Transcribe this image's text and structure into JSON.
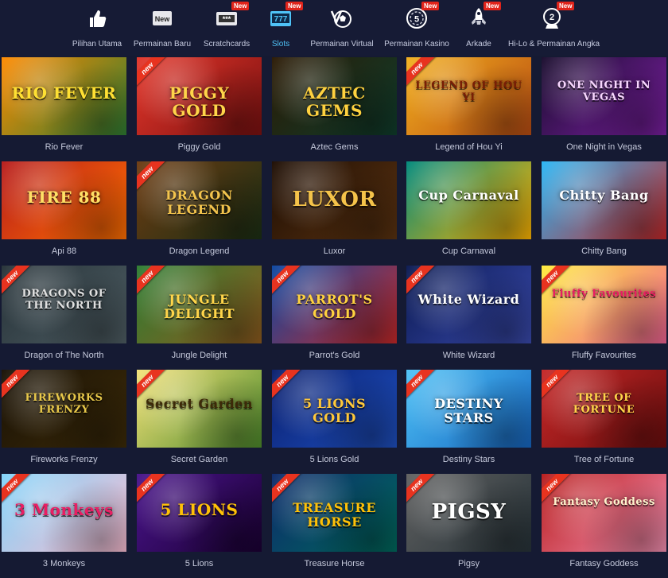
{
  "nav": {
    "items": [
      {
        "label": "Pilihan Utama",
        "icon": "thumbs-up-icon",
        "new": false,
        "active": false
      },
      {
        "label": "Permainan Baru",
        "icon": "new-box-icon",
        "new": false,
        "active": false
      },
      {
        "label": "Scratchcards",
        "icon": "scratchcard-icon",
        "new": true,
        "active": false
      },
      {
        "label": "Slots",
        "icon": "slot-777-icon",
        "new": true,
        "active": true
      },
      {
        "label": "Permainan Virtual",
        "icon": "soccer-v-icon",
        "new": false,
        "active": false
      },
      {
        "label": "Permainan Kasino",
        "icon": "casino-chip-icon",
        "new": true,
        "active": false
      },
      {
        "label": "Arkade",
        "icon": "rocket-icon",
        "new": true,
        "active": false
      },
      {
        "label": "Hi-Lo & Permainan Angka",
        "icon": "lottery-icon",
        "new": true,
        "active": false
      }
    ],
    "new_badge": "New",
    "new_box_text": "New",
    "scratch_text": "***",
    "slot_text": "777",
    "chip_text": "5",
    "lottery_text": "2"
  },
  "ribbon_text": "new",
  "games": [
    {
      "name": "Rio Fever",
      "art": "RIO FEVER",
      "new": false,
      "c1": "#ff8a00",
      "c2": "#2e7d32",
      "tc": "#ffe033"
    },
    {
      "name": "Piggy Gold",
      "art": "PIGGY GOLD",
      "new": true,
      "c1": "#e5372b",
      "c2": "#7a1010",
      "tc": "#ffd54a"
    },
    {
      "name": "Aztec Gems",
      "art": "AZTEC GEMS",
      "new": false,
      "c1": "#2b1a05",
      "c2": "#0f3d2c",
      "tc": "#ffd23f"
    },
    {
      "name": "Legend of Hou Yi",
      "art": "LEGEND OF HOU YI",
      "new": true,
      "c1": "#f2b01e",
      "c2": "#b84b12",
      "tc": "#7a1e05"
    },
    {
      "name": "One Night in Vegas",
      "art": "ONE NIGHT IN VEGAS",
      "new": false,
      "c1": "#1a0d2e",
      "c2": "#7b1fa2",
      "tc": "#f8d7ff"
    },
    {
      "name": "Api 88",
      "art": "FIRE 88",
      "new": false,
      "c1": "#b71c1c",
      "c2": "#ff6f00",
      "tc": "#ffe066"
    },
    {
      "name": "Dragon Legend",
      "art": "DRAGON LEGEND",
      "new": true,
      "c1": "#6d3b12",
      "c2": "#1b2f14",
      "tc": "#f3c44d"
    },
    {
      "name": "Luxor",
      "art": "LUXOR",
      "new": false,
      "c1": "#1e0e04",
      "c2": "#5a3210",
      "tc": "#f5c34a"
    },
    {
      "name": "Cup Carnaval",
      "art": "Cup Carnaval",
      "new": false,
      "c1": "#00897b",
      "c2": "#ffb300",
      "tc": "#ffffff"
    },
    {
      "name": "Chitty Bang",
      "art": "Chitty Bang",
      "new": false,
      "c1": "#29b6f6",
      "c2": "#c62828",
      "tc": "#ffffff"
    },
    {
      "name": "Dragon of The North",
      "art": "DRAGONS OF THE NORTH",
      "new": true,
      "c1": "#263238",
      "c2": "#4e5d63",
      "tc": "#e0e0e0"
    },
    {
      "name": "Jungle Delight",
      "art": "JUNGLE DELIGHT",
      "new": true,
      "c1": "#2e7d32",
      "c2": "#8d5a1e",
      "tc": "#ffd54a"
    },
    {
      "name": "Parrot's Gold",
      "art": "PARROT'S GOLD",
      "new": true,
      "c1": "#0d47a1",
      "c2": "#c62828",
      "tc": "#ffd23f"
    },
    {
      "name": "White Wizard",
      "art": "White Wizard",
      "new": true,
      "c1": "#0b1a52",
      "c2": "#3949ab",
      "tc": "#ffffff"
    },
    {
      "name": "Fluffy Favourites",
      "art": "Fluffy Favourites",
      "new": true,
      "c1": "#ffeb3b",
      "c2": "#f06292",
      "tc": "#e91e63"
    },
    {
      "name": "Fireworks Frenzy",
      "art": "FIREWORKS FRENZY",
      "new": true,
      "c1": "#1a1206",
      "c2": "#3b2a08",
      "tc": "#e8c84a"
    },
    {
      "name": "Secret Garden",
      "art": "Secret Garden",
      "new": true,
      "c1": "#f4e27a",
      "c2": "#4c8a2a",
      "tc": "#3d2a08"
    },
    {
      "name": "5 Lions Gold",
      "art": "5 LIONS GOLD",
      "new": true,
      "c1": "#0a1f6e",
      "c2": "#1e4fbf",
      "tc": "#ffc83a"
    },
    {
      "name": "Destiny Stars",
      "art": "DESTINY STARS",
      "new": true,
      "c1": "#4fc3f7",
      "c2": "#1565c0",
      "tc": "#ffffff"
    },
    {
      "name": "Tree of Fortune",
      "art": "TREE OF FORTUNE",
      "new": true,
      "c1": "#c62828",
      "c2": "#6d0d0d",
      "tc": "#ffd54a"
    },
    {
      "name": "3 Monkeys",
      "art": "3 Monkeys",
      "new": true,
      "c1": "#81d4fa",
      "c2": "#f8bbd0",
      "tc": "#e91e63"
    },
    {
      "name": "5 Lions",
      "art": "5 LIONS",
      "new": true,
      "c1": "#4a148c",
      "c2": "#1a0033",
      "tc": "#ffc107"
    },
    {
      "name": "Treasure Horse",
      "art": "TREASURE HORSE",
      "new": true,
      "c1": "#0d2a6b",
      "c2": "#00695c",
      "tc": "#ffc107"
    },
    {
      "name": "Pigsy",
      "art": "PIGSY",
      "new": true,
      "c1": "#616161",
      "c2": "#263238",
      "tc": "#ffffff"
    },
    {
      "name": "Fantasy Goddess",
      "art": "Fantasy Goddess",
      "new": true,
      "c1": "#b71c1c",
      "c2": "#f48fb1",
      "tc": "#fff3cd"
    }
  ]
}
